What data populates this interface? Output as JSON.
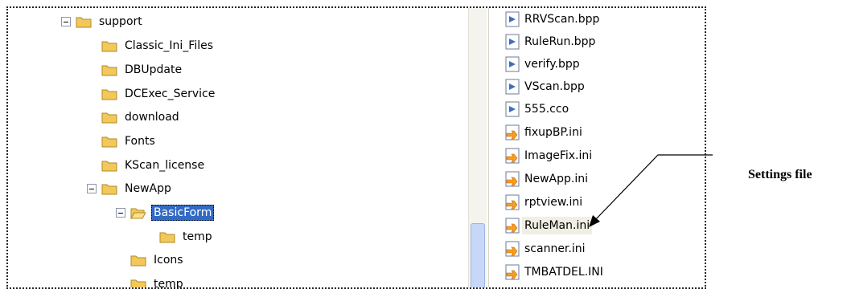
{
  "tree": {
    "support": "support",
    "classic_ini_files": "Classic_Ini_Files",
    "dbupdate": "DBUpdate",
    "dcexec_service": "DCExec_Service",
    "download": "download",
    "fonts": "Fonts",
    "kscan_license": "KScan_license",
    "newapp": "NewApp",
    "basicform": "BasicForm",
    "basicform_temp": "temp",
    "icons": "Icons",
    "temp": "temp"
  },
  "files": [
    "RRVScan.bpp",
    "RuleRun.bpp",
    "verify.bpp",
    "VScan.bpp",
    "555.cco",
    "fixupBP.ini",
    "ImageFix.ini",
    "NewApp.ini",
    "rptview.ini",
    "RuleMan.ini",
    "scanner.ini",
    "TMBATDEL.INI"
  ],
  "annotation": {
    "label": "Settings file"
  },
  "colors": {
    "selection": "#316ac5",
    "folder": "#f2c85a",
    "bpp_icon": "#3b6fc4",
    "ini_icon": "#ff9c1a"
  }
}
